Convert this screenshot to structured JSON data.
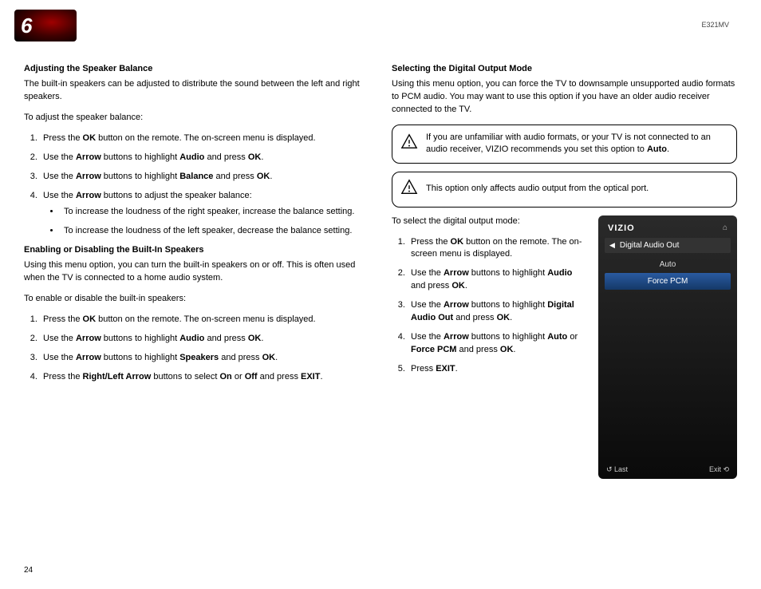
{
  "chapter_number": "6",
  "model": "E321MV",
  "page_number": "24",
  "left": {
    "s1_heading": "Adjusting the Speaker Balance",
    "s1_intro": "The built-in speakers can be adjusted to distribute the sound between the left and right speakers.",
    "s1_lead": "To adjust the speaker balance:",
    "s1_step1a": "Press the ",
    "s1_step1b": "OK",
    "s1_step1c": " button on the remote. The on-screen menu is displayed.",
    "s1_step2a": "Use the ",
    "s1_step2b": "Arrow",
    "s1_step2c": " buttons to highlight ",
    "s1_step2d": "Audio",
    "s1_step2e": " and press ",
    "s1_step2f": "OK",
    "s1_step2g": ".",
    "s1_step3a": "Use the ",
    "s1_step3b": "Arrow",
    "s1_step3c": " buttons to highlight ",
    "s1_step3d": "Balance",
    "s1_step3e": " and press ",
    "s1_step3f": "OK",
    "s1_step3g": ".",
    "s1_step4a": "Use the ",
    "s1_step4b": "Arrow",
    "s1_step4c": " buttons to adjust the speaker balance:",
    "s1_bullet1": "To increase the loudness of the right speaker, increase the balance setting.",
    "s1_bullet2": "To increase the loudness of the left speaker, decrease the balance setting.",
    "s2_heading": "Enabling or Disabling the Built-In Speakers",
    "s2_intro": "Using this menu option, you can turn the built-in speakers on or off. This is often used when the TV is connected to a home audio system.",
    "s2_lead": "To enable or disable the built-in speakers:",
    "s2_step1a": "Press the ",
    "s2_step1b": "OK",
    "s2_step1c": " button on the remote. The on-screen menu is displayed.",
    "s2_step2a": "Use the ",
    "s2_step2b": "Arrow",
    "s2_step2c": " buttons to highlight ",
    "s2_step2d": "Audio",
    "s2_step2e": " and press ",
    "s2_step2f": "OK",
    "s2_step2g": ".",
    "s2_step3a": "Use the ",
    "s2_step3b": "Arrow",
    "s2_step3c": " buttons to highlight ",
    "s2_step3d": "Speakers",
    "s2_step3e": " and press ",
    "s2_step3f": "OK",
    "s2_step3g": ".",
    "s2_step4a": "Press the ",
    "s2_step4b": "Right/Left Arrow",
    "s2_step4c": " buttons to select ",
    "s2_step4d": "On",
    "s2_step4e": " or ",
    "s2_step4f": "Off",
    "s2_step4g": " and press ",
    "s2_step4h": "EXIT",
    "s2_step4i": "."
  },
  "right": {
    "s3_heading": "Selecting the Digital Output Mode",
    "s3_intro": "Using this menu option, you can force the TV to downsample unsupported audio formats to PCM audio. You may want to use this option if you have an older audio receiver connected to the TV.",
    "note1a": "If you are unfamiliar with audio formats, or your TV is not connected to an audio receiver, VIZIO recommends you set this option to ",
    "note1b": "Auto",
    "note1c": ".",
    "note2": "This option only affects audio output from the optical port.",
    "s3_lead": "To select the digital output mode:",
    "s3_step1a": "Press the ",
    "s3_step1b": "OK",
    "s3_step1c": " button on the remote. The on-screen menu is displayed.",
    "s3_step2a": "Use the ",
    "s3_step2b": "Arrow",
    "s3_step2c": " buttons to highlight ",
    "s3_step2d": "Audio",
    "s3_step2e": " and press ",
    "s3_step2f": "OK",
    "s3_step2g": ".",
    "s3_step3a": "Use the ",
    "s3_step3b": "Arrow",
    "s3_step3c": " buttons to highlight ",
    "s3_step3d": "Digital Audio Out",
    "s3_step3e": " and press ",
    "s3_step3f": "OK",
    "s3_step3g": ".",
    "s3_step4a": "Use the ",
    "s3_step4b": "Arrow",
    "s3_step4c": " buttons to highlight ",
    "s3_step4d": "Auto",
    "s3_step4e": " or ",
    "s3_step4f": "Force PCM",
    "s3_step4g": " and press ",
    "s3_step4h": "OK",
    "s3_step4i": ".",
    "s3_step5a": "Press ",
    "s3_step5b": "EXIT",
    "s3_step5c": "."
  },
  "tv": {
    "logo": "VIZIO",
    "submenu": "Digital Audio Out",
    "item1": "Auto",
    "item2": "Force PCM",
    "footer_left": "Last",
    "footer_right": "Exit"
  }
}
